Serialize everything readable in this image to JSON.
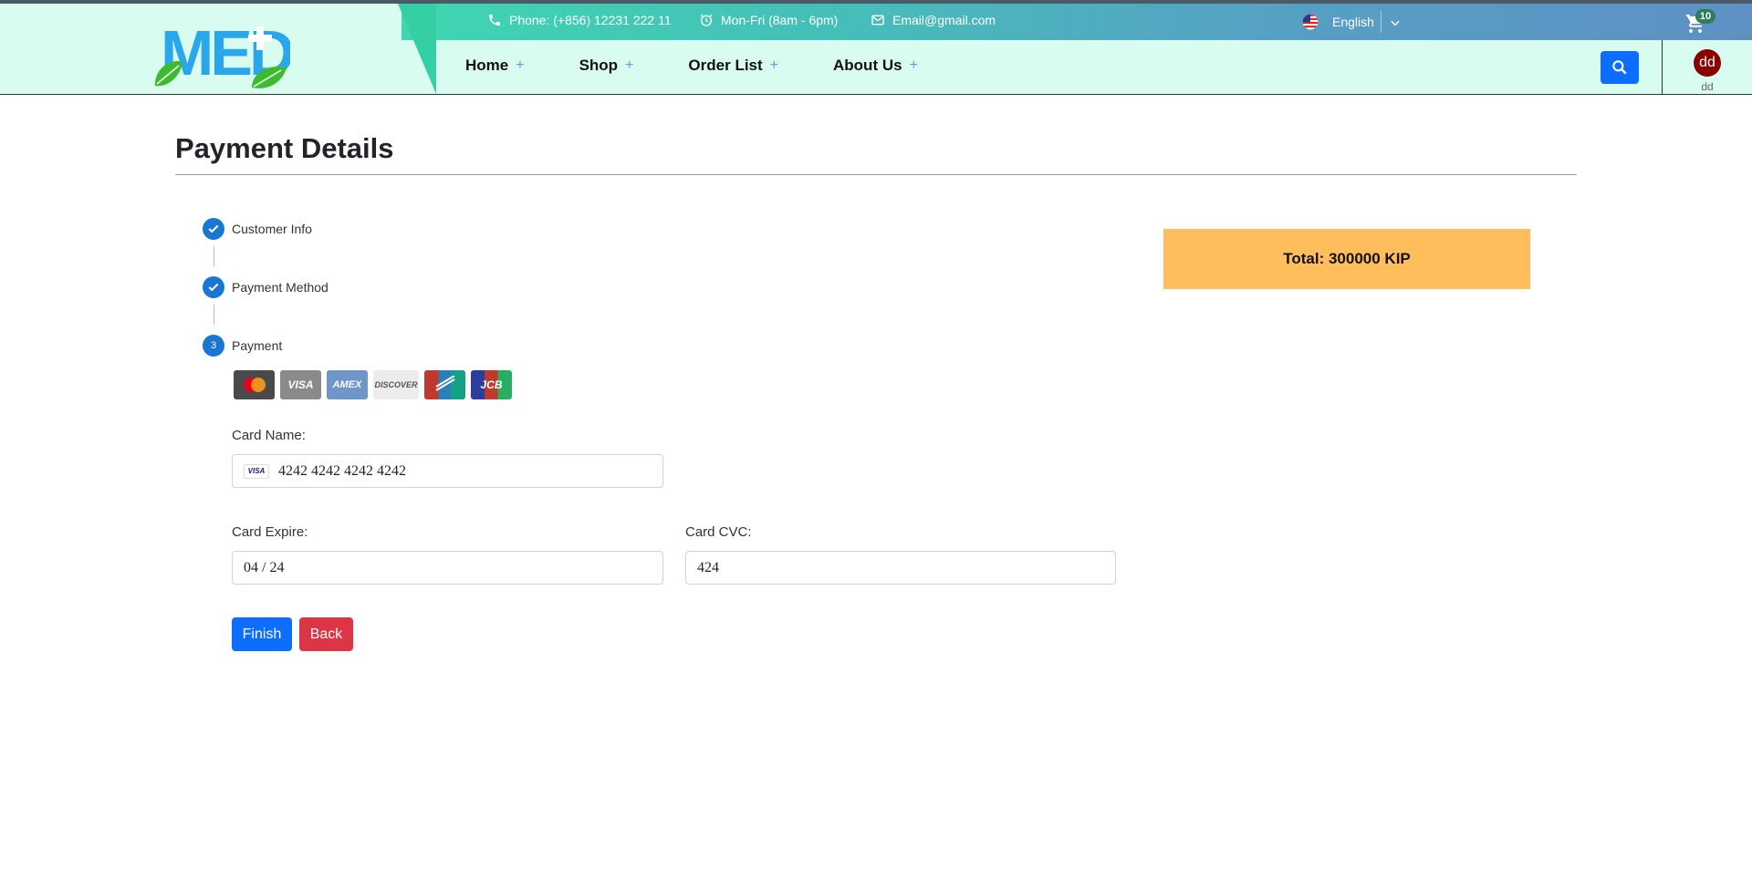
{
  "header": {
    "logo_text": "MED",
    "phone": "Phone: (+856) 12231 222 11",
    "hours": "Mon-Fri (8am - 6pm)",
    "email": "Email@gmail.com",
    "language": "English",
    "cart_count": "10",
    "nav": [
      {
        "label": "Home",
        "plus": "+"
      },
      {
        "label": "Shop",
        "plus": "+"
      },
      {
        "label": "Order List",
        "plus": "+"
      },
      {
        "label": "About Us",
        "plus": "+"
      }
    ],
    "user": {
      "initials": "dd",
      "name": "dd"
    }
  },
  "page": {
    "title": "Payment Details"
  },
  "steps": [
    {
      "label": "Customer Info",
      "status": "done"
    },
    {
      "label": "Payment Method",
      "status": "done"
    },
    {
      "label": "Payment",
      "status": "active",
      "number": "3"
    }
  ],
  "card_brands": [
    "MC",
    "VISA",
    "AMEX",
    "DISCOVER",
    "DC",
    "JCB"
  ],
  "form": {
    "card_name_label": "Card Name:",
    "card_number": "4242 4242 4242 4242",
    "card_brand_badge": "VISA",
    "card_expire_label": "Card Expire:",
    "card_expire": "04 / 24",
    "card_cvc_label": "Card CVC:",
    "card_cvc": "424",
    "finish_label": "Finish",
    "back_label": "Back"
  },
  "summary": {
    "total": "Total: 300000 KIP"
  },
  "colors": {
    "primary": "#0d6efd",
    "danger": "#dc3545",
    "step": "#1976d2",
    "total_bg": "#ffbd5c",
    "header_bg": "#d8fcef"
  }
}
